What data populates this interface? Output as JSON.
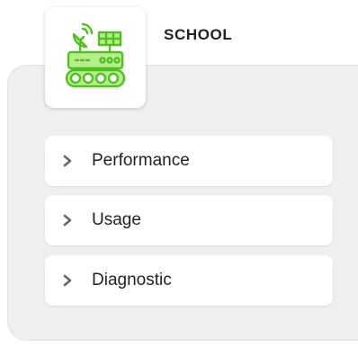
{
  "header": {
    "title": "SCHOOL",
    "device_icon": "satellite-rover-icon"
  },
  "menu": {
    "items": [
      {
        "label": "Performance",
        "icon": "chevron-right-icon"
      },
      {
        "label": "Usage",
        "icon": "chevron-right-icon"
      },
      {
        "label": "Diagnostic",
        "icon": "chevron-right-icon"
      }
    ]
  },
  "colors": {
    "icon_green": "#4fc21f",
    "icon_fill": "#b9ec8f",
    "panel_bg": "#efefef",
    "chevron": "#666666"
  }
}
